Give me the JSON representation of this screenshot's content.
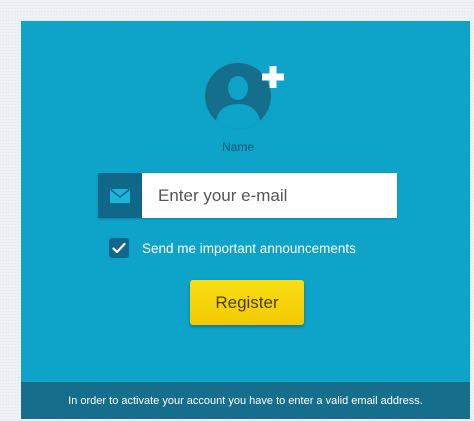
{
  "avatar": {
    "label": "Name",
    "icon": "user-silhouette-icon",
    "add_icon": "plus-icon"
  },
  "email": {
    "icon": "envelope-icon",
    "placeholder": "Enter your e-mail",
    "value": ""
  },
  "announcements": {
    "checked": true,
    "label": "Send me important announcements"
  },
  "register": {
    "label": "Register"
  },
  "footer": {
    "text": "In order to activate your account you have to enter a valid email address."
  },
  "colors": {
    "panel": "#0ea3c8",
    "dark_accent": "#156f8c",
    "button": "#f5d000"
  }
}
